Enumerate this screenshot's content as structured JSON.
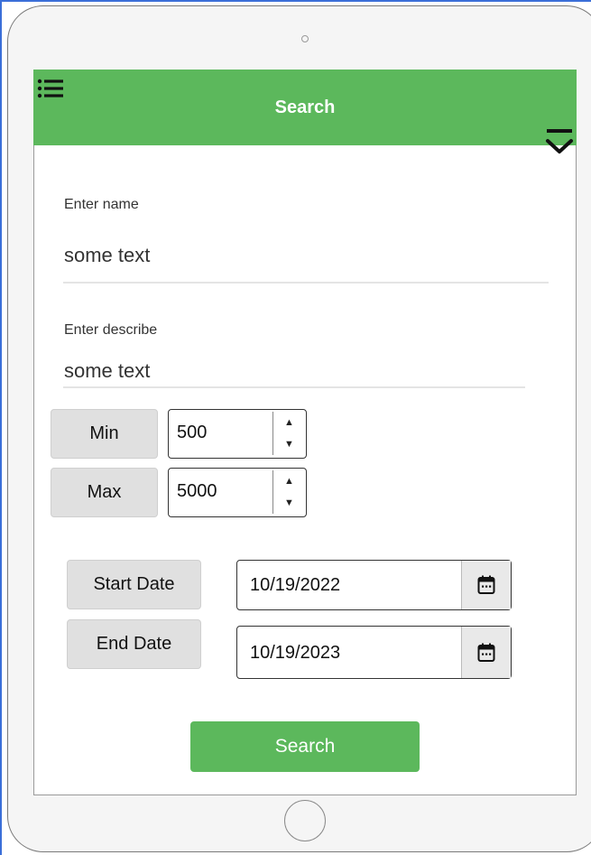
{
  "header": {
    "title": "Search",
    "background_color": "#5cb85c"
  },
  "icons": {
    "menu": "menu-list-icon",
    "collapse": "collapse-down-icon",
    "calendar": "calendar-icon"
  },
  "form": {
    "name": {
      "label": "Enter name",
      "value": "some text"
    },
    "describe": {
      "label": "Enter describe",
      "value": "some text"
    },
    "min": {
      "label": "Min",
      "value": "500"
    },
    "max": {
      "label": "Max",
      "value": "5000"
    },
    "start_date": {
      "label": "Start Date",
      "value": "10/19/2022"
    },
    "end_date": {
      "label": "End Date",
      "value": "10/19/2023"
    }
  },
  "spinner": {
    "up": "▲",
    "down": "▼"
  },
  "search_button": {
    "label": "Search",
    "background_color": "#5cb85c"
  }
}
